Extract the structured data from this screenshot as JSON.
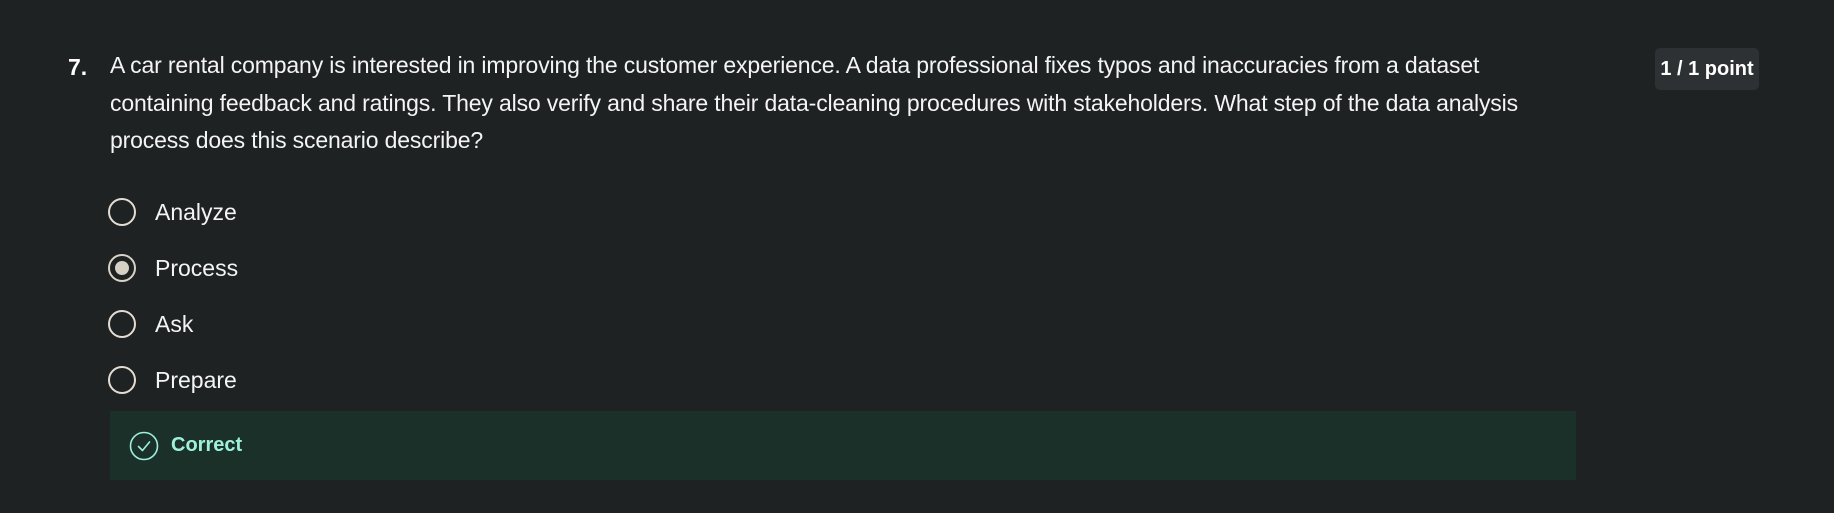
{
  "question": {
    "number": "7.",
    "text": "A car rental company is interested in improving the customer experience. A data professional fixes typos and inaccuracies from a dataset containing feedback and ratings. They also verify and share their data-cleaning procedures with stakeholders. What step of the data analysis process does this scenario describe?",
    "points": "1 / 1 point"
  },
  "options": [
    {
      "label": "Analyze",
      "selected": false
    },
    {
      "label": "Process",
      "selected": true
    },
    {
      "label": "Ask",
      "selected": false
    },
    {
      "label": "Prepare",
      "selected": false
    }
  ],
  "feedback": {
    "label": "Correct",
    "icon": "check-circle-icon"
  },
  "colors": {
    "background": "#1f2223",
    "feedback_background": "#1b3029",
    "feedback_text": "#9ff0da",
    "points_badge": "#2d3133"
  }
}
